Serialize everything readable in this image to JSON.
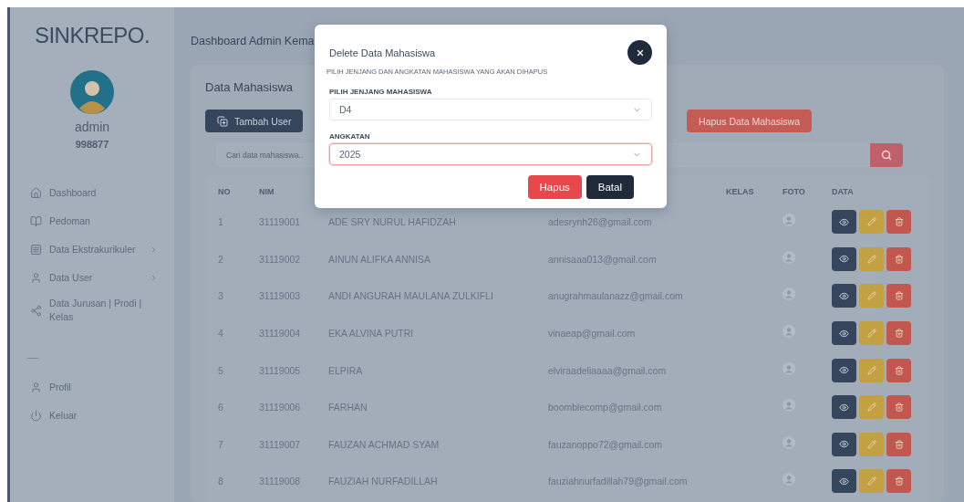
{
  "sidebar": {
    "brand": "SINKREPO.",
    "profile": {
      "name": "admin",
      "id": "998877"
    },
    "items": [
      {
        "kind": "home",
        "label": "Dashboard",
        "has_submenu": false
      },
      {
        "kind": "book",
        "label": "Pedoman",
        "has_submenu": false
      },
      {
        "kind": "list",
        "label": "Data Ekstrakurikuler",
        "has_submenu": true
      },
      {
        "kind": "user",
        "label": "Data User",
        "has_submenu": true
      },
      {
        "kind": "share",
        "label": "Data Jurusan | Prodi | Kelas",
        "has_submenu": false
      }
    ],
    "bottom_items": [
      {
        "kind": "user",
        "label": "Profil",
        "has_submenu": false
      },
      {
        "kind": "power",
        "label": "Keluar",
        "has_submenu": false
      }
    ]
  },
  "header": {
    "title": "Dashboard Admin Kema"
  },
  "card": {
    "title": "Data Mahasiswa",
    "add_button": "Tambah User",
    "delete_button": "Hapus Data Mahasiswa",
    "search": {
      "placeholder": "Cari data mahasiswa.."
    },
    "table": {
      "columns": [
        "NO",
        "NIM",
        "KELAS",
        "FOTO",
        "DATA"
      ],
      "rows": [
        {
          "no": "1",
          "nim": "31119001",
          "name": "ADE SRY NURUL HAFIDZAH",
          "email": "adesrynh26@gmail.com"
        },
        {
          "no": "2",
          "nim": "31119002",
          "name": "AINUN ALIFKA ANNISA",
          "email": "annisaaa013@gmail.com"
        },
        {
          "no": "3",
          "nim": "31119003",
          "name": "ANDI ANGURAH MAULANA ZULKIFLI",
          "email": "anugrahmaulanazz@gmail.com"
        },
        {
          "no": "4",
          "nim": "31119004",
          "name": "EKA ALVINA PUTRI",
          "email": "vinaeap@gmail.com"
        },
        {
          "no": "5",
          "nim": "31119005",
          "name": "ELPIRA",
          "email": "elviraadeliaaaa@gmail.com"
        },
        {
          "no": "6",
          "nim": "31119006",
          "name": "FARHAN",
          "email": "boomblecomp@gmail.com"
        },
        {
          "no": "7",
          "nim": "31119007",
          "name": "FAUZAN ACHMAD SYAM",
          "email": "fauzanoppo72@gmail.com"
        },
        {
          "no": "8",
          "nim": "31119008",
          "name": "FAUZIAH NURFADILLAH",
          "email": "fauziahnurfadillah79@gmail.com"
        }
      ]
    }
  },
  "modal": {
    "title": "Delete Data Mahasiswa",
    "subtitle": "PILIH JENJANG DAN ANGKATAN MAHASISWA YANG AKAN DIHAPUS",
    "fields": [
      {
        "label": "PILIH JENJANG MAHASISWA",
        "value": "D4",
        "focused": false
      },
      {
        "label": "ANGKATAN",
        "value": "2025",
        "focused": true
      }
    ],
    "buttons": [
      {
        "kind": "danger",
        "label": "Hapus"
      },
      {
        "kind": "dark",
        "label": "Batal"
      }
    ]
  }
}
